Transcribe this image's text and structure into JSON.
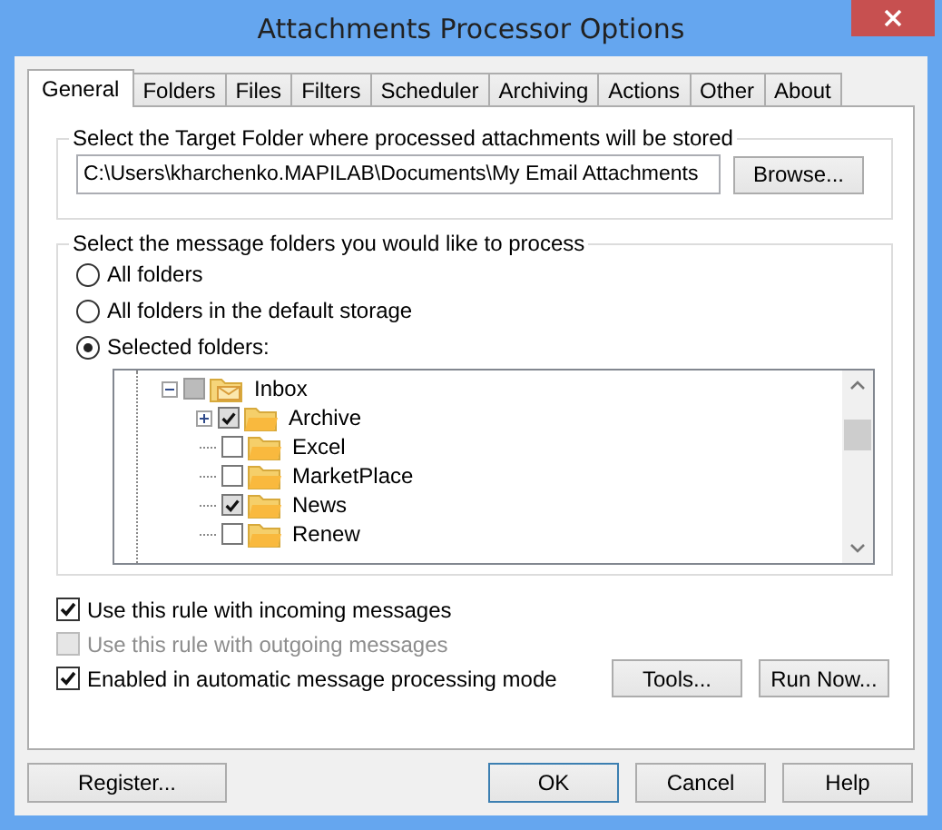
{
  "window": {
    "title": "Attachments Processor Options"
  },
  "tabs": [
    {
      "label": "General",
      "selected": true
    },
    {
      "label": "Folders",
      "selected": false
    },
    {
      "label": "Files",
      "selected": false
    },
    {
      "label": "Filters",
      "selected": false
    },
    {
      "label": "Scheduler",
      "selected": false
    },
    {
      "label": "Archiving",
      "selected": false
    },
    {
      "label": "Actions",
      "selected": false
    },
    {
      "label": "Other",
      "selected": false
    },
    {
      "label": "About",
      "selected": false
    }
  ],
  "target_folder": {
    "legend": "Select the Target Folder where processed attachments will be stored",
    "path": "C:\\Users\\kharchenko.MAPILAB\\Documents\\My Email Attachments",
    "browse_button": "Browse..."
  },
  "message_folders": {
    "legend": "Select the message folders you would like to process",
    "options": [
      {
        "label": "All folders",
        "selected": false
      },
      {
        "label": "All folders in the default storage",
        "selected": false
      },
      {
        "label": "Selected folders:",
        "selected": true
      }
    ],
    "tree": [
      {
        "label": "Inbox",
        "kind": "inbox",
        "mixed": true,
        "expanded": true,
        "children": [
          {
            "label": "Archive",
            "kind": "folder",
            "checked": true,
            "expanded": false
          },
          {
            "label": "Excel",
            "kind": "folder",
            "checked": false
          },
          {
            "label": "MarketPlace",
            "kind": "folder",
            "checked": false
          },
          {
            "label": "News",
            "kind": "folder",
            "checked": true
          },
          {
            "label": "Renew",
            "kind": "folder",
            "checked": false
          }
        ]
      }
    ]
  },
  "options": [
    {
      "label": "Use this rule with incoming messages",
      "checked": true,
      "disabled": false
    },
    {
      "label": "Use this rule with outgoing messages",
      "checked": false,
      "disabled": true
    },
    {
      "label": "Enabled in automatic message processing mode",
      "checked": true,
      "disabled": false
    }
  ],
  "panel_buttons": [
    "Tools...",
    "Run Now..."
  ],
  "footer_buttons": [
    {
      "label": "Register...",
      "default": false
    },
    {
      "label": "OK",
      "default": true
    },
    {
      "label": "Cancel",
      "default": false
    },
    {
      "label": "Help",
      "default": false
    }
  ]
}
